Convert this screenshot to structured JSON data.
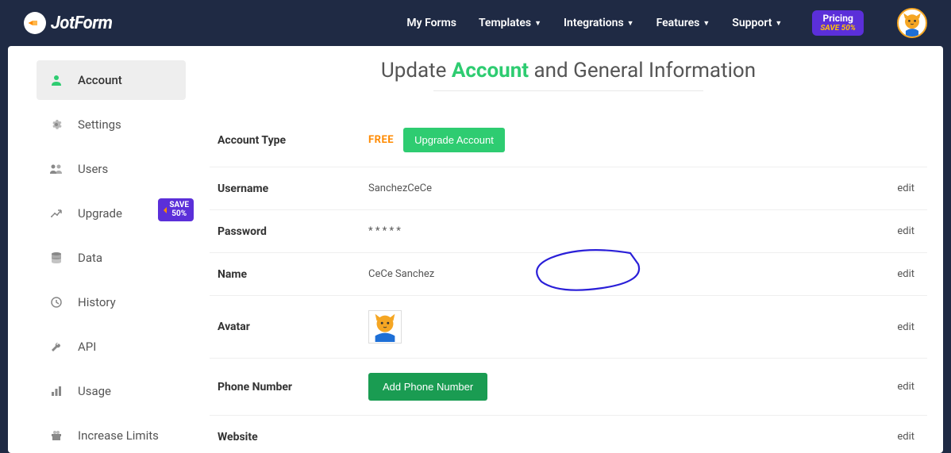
{
  "header": {
    "logo_text": "JotForm",
    "nav": [
      {
        "label": "My Forms",
        "caret": false
      },
      {
        "label": "Templates",
        "caret": true
      },
      {
        "label": "Integrations",
        "caret": true
      },
      {
        "label": "Features",
        "caret": true
      },
      {
        "label": "Support",
        "caret": true
      }
    ],
    "pricing": {
      "top": "Pricing",
      "bottom": "SAVE 50%"
    }
  },
  "sidebar": {
    "items": [
      {
        "label": "Account"
      },
      {
        "label": "Settings"
      },
      {
        "label": "Users"
      },
      {
        "label": "Upgrade",
        "badge": {
          "line1": "SAVE",
          "line2": "50%"
        }
      },
      {
        "label": "Data"
      },
      {
        "label": "History"
      },
      {
        "label": "API"
      },
      {
        "label": "Usage"
      },
      {
        "label": "Increase Limits"
      }
    ]
  },
  "main": {
    "title_pre": "Update ",
    "title_accent": "Account",
    "title_post": " and General Information",
    "rows": {
      "account_type": {
        "label": "Account Type",
        "value": "FREE",
        "button": "Upgrade Account"
      },
      "username": {
        "label": "Username",
        "value": "SanchezCeCe",
        "edit": "edit"
      },
      "password": {
        "label": "Password",
        "value": "* * * * *",
        "edit": "edit"
      },
      "name": {
        "label": "Name",
        "value": "CeCe Sanchez",
        "edit": "edit"
      },
      "avatar": {
        "label": "Avatar",
        "edit": "edit"
      },
      "phone": {
        "label": "Phone Number",
        "button": "Add Phone Number",
        "edit": "edit"
      },
      "website": {
        "label": "Website",
        "edit": "edit"
      }
    }
  }
}
